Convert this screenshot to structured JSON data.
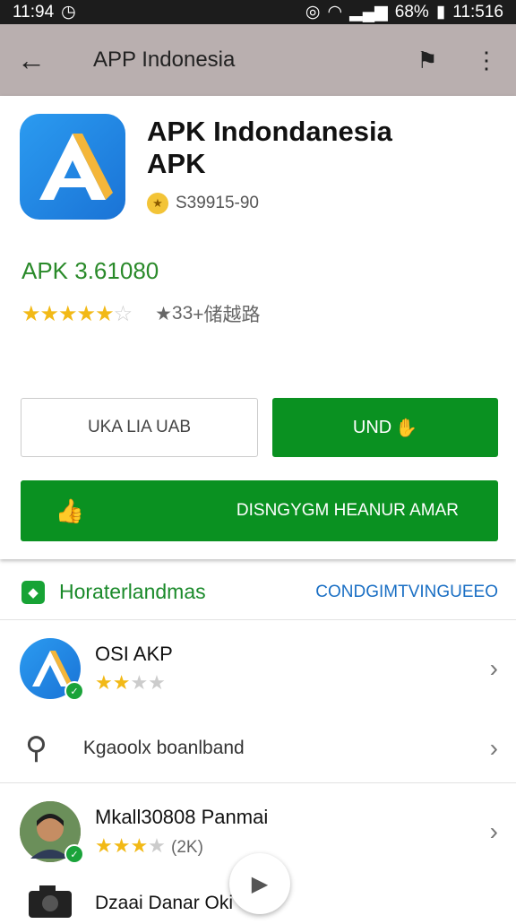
{
  "status_bar": {
    "time_left": "11:94",
    "battery_text": "68%",
    "time_right": "11:516"
  },
  "app_bar": {
    "title": "APP Indonesia"
  },
  "app": {
    "name_line1": "APK Indondanesia",
    "name_line2": "APK",
    "developer": "S39915-90",
    "version": "APK 3.61080",
    "rating_value": 4.5,
    "rating_count_text": "33",
    "rating_suffix": "+储越路"
  },
  "buttons": {
    "secondary": "UKA LIA UAB",
    "primary": "UND",
    "wide": "DISNGYGM HEANUR AMAR"
  },
  "section": {
    "title": "Horaterlandmas",
    "link": "CONDGIMTVINGUEEO"
  },
  "list": [
    {
      "name": "OSI AKP",
      "stars": 2
    },
    {
      "name": "Kgaoolx boanlband"
    },
    {
      "name": "Mkall30808 Panmai",
      "stars": 3,
      "count": "(2K)"
    },
    {
      "name": "Dzaai Danar Oki"
    }
  ],
  "colors": {
    "accent_green": "#0a9121",
    "star": "#f2b916",
    "app_bar": "#b9afaf"
  }
}
